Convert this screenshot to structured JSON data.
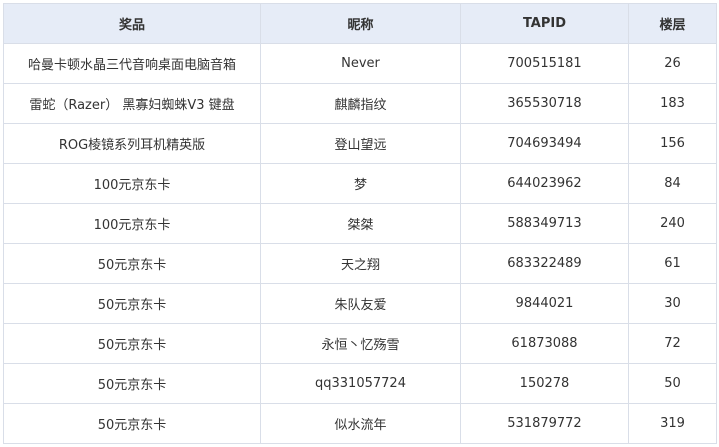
{
  "table": {
    "headers": [
      "奖品",
      "昵称",
      "TAPID",
      "楼层"
    ],
    "rows": [
      [
        "哈曼卡顿水晶三代音响桌面电脑音箱",
        "Never",
        "700515181",
        "26"
      ],
      [
        "雷蛇（Razer） 黑寡妇蜘蛛V3 键盘",
        "麒麟指纹",
        "365530718",
        "183"
      ],
      [
        "ROG棱镜系列耳机精英版",
        "登山望远",
        "704693494",
        "156"
      ],
      [
        "100元京东卡",
        "梦",
        "644023962",
        "84"
      ],
      [
        "100元京东卡",
        "桀桀",
        "588349713",
        "240"
      ],
      [
        "50元京东卡",
        "天之翔",
        "683322489",
        "61"
      ],
      [
        "50元京东卡",
        "朱队友爱",
        "9844021",
        "30"
      ],
      [
        "50元京东卡",
        "永恒丶忆殇雪",
        "61873088",
        "72"
      ],
      [
        "50元京东卡",
        "qq331057724",
        "150278",
        "50"
      ],
      [
        "50元京东卡",
        "似水流年",
        "531879772",
        "319"
      ]
    ]
  },
  "colors": {
    "header_bg": "#e6ecf7",
    "border": "#d9dee8",
    "text": "#333333"
  }
}
